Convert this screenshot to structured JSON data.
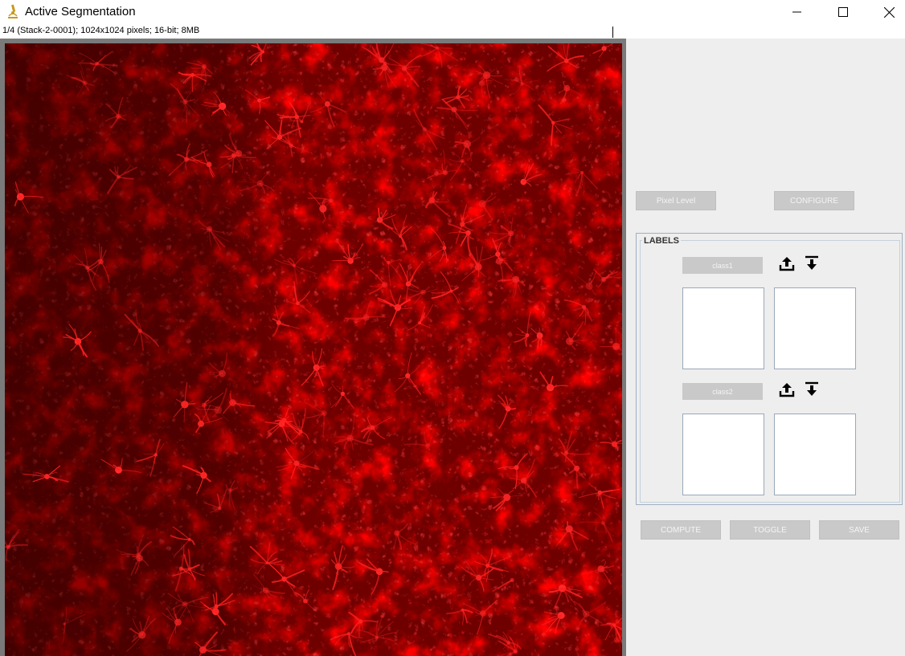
{
  "window": {
    "title": "Active Segmentation",
    "minimize_icon": "minimize-icon",
    "maximize_icon": "maximize-icon",
    "close_icon": "close-icon"
  },
  "image_info": "1/4 (Stack-2-0001); 1024x1024 pixels; 16-bit; 8MB",
  "image": {
    "description_color": "#e00000"
  },
  "controls": {
    "pixel_level": "Pixel Level",
    "configure": "CONFIGURE"
  },
  "labels": {
    "title": "LABELS",
    "classes": [
      {
        "name": "class1",
        "upload_icon": "upload-icon",
        "download_icon": "download-icon"
      },
      {
        "name": "class2",
        "upload_icon": "upload-icon",
        "download_icon": "download-icon"
      }
    ]
  },
  "actions": {
    "compute": "COMPUTE",
    "toggle": "TOGGLE",
    "save": "SAVE"
  },
  "colors": {
    "panel_bg": "#eeeeee",
    "button_bg": "#c9c9c9",
    "image_accent": "#ff1a1a"
  }
}
